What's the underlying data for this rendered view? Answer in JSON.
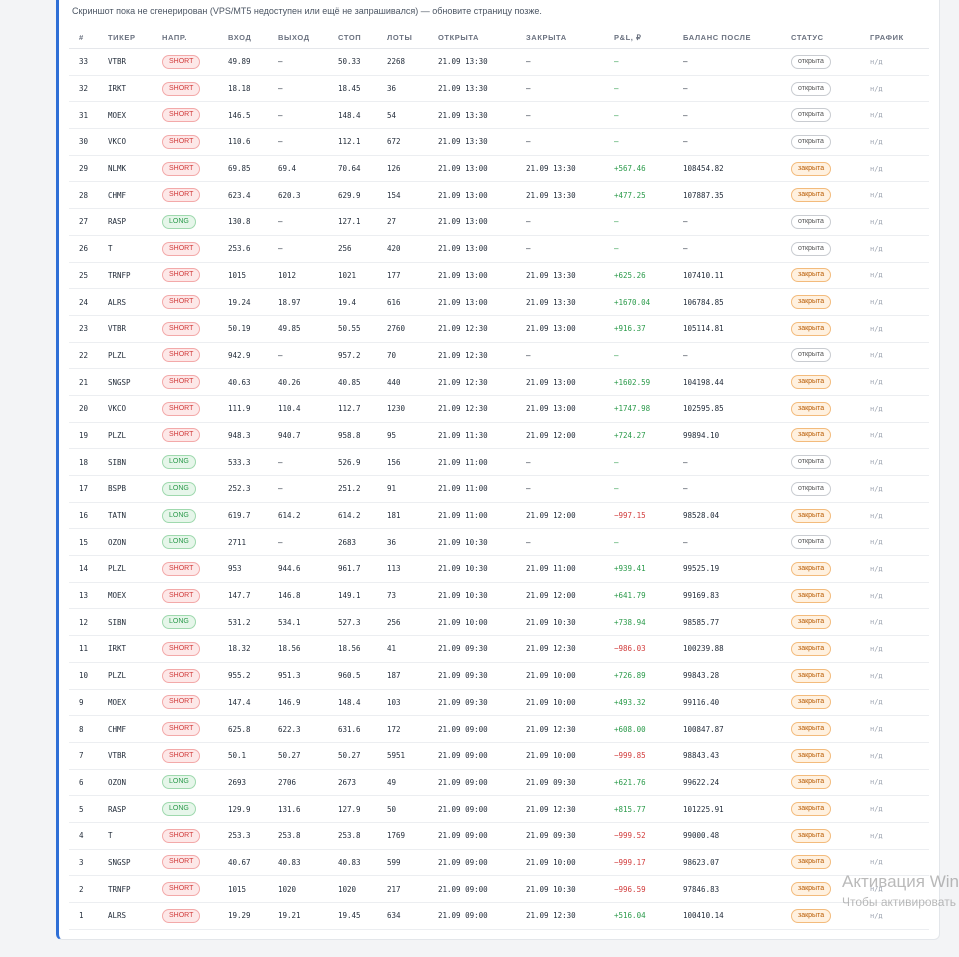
{
  "notice": "Скриншот пока не сгенерирован (VPS/MT5 недоступен или ещё не запрашивался) — обновите страницу позже.",
  "columns": [
    "#",
    "ТИКЕР",
    "НАПР.",
    "ВХОД",
    "ВЫХОД",
    "СТОП",
    "ЛОТЫ",
    "ОТКРЫТА",
    "ЗАКРЫТА",
    "P&L, ₽",
    "БАЛАНС ПОСЛЕ",
    "СТАТУС",
    "ГРАФИК"
  ],
  "colors": {
    "accent": "#2f6fd6",
    "short": "#d13b3b",
    "long": "#2a9a4a",
    "closed": "#b85a00"
  },
  "rows": [
    {
      "n": "33",
      "ticker": "VTBR",
      "dir": "SHORT",
      "entry": "49.89",
      "exit": "–",
      "stop": "50.33",
      "lots": "2268",
      "opened": "21.09 13:30",
      "closed": "–",
      "pnl": "–",
      "balance": "–",
      "status": "открыта",
      "chart": "н/д"
    },
    {
      "n": "32",
      "ticker": "IRKT",
      "dir": "SHORT",
      "entry": "18.18",
      "exit": "–",
      "stop": "18.45",
      "lots": "36",
      "opened": "21.09 13:30",
      "closed": "–",
      "pnl": "–",
      "balance": "–",
      "status": "открыта",
      "chart": "н/д"
    },
    {
      "n": "31",
      "ticker": "MOEX",
      "dir": "SHORT",
      "entry": "146.5",
      "exit": "–",
      "stop": "148.4",
      "lots": "54",
      "opened": "21.09 13:30",
      "closed": "–",
      "pnl": "–",
      "balance": "–",
      "status": "открыта",
      "chart": "н/д"
    },
    {
      "n": "30",
      "ticker": "VKCO",
      "dir": "SHORT",
      "entry": "110.6",
      "exit": "–",
      "stop": "112.1",
      "lots": "672",
      "opened": "21.09 13:30",
      "closed": "–",
      "pnl": "–",
      "balance": "–",
      "status": "открыта",
      "chart": "н/д"
    },
    {
      "n": "29",
      "ticker": "NLMK",
      "dir": "SHORT",
      "entry": "69.85",
      "exit": "69.4",
      "stop": "70.64",
      "lots": "126",
      "opened": "21.09 13:00",
      "closed": "21.09 13:30",
      "pnl": "+567.46",
      "balance": "108454.82",
      "status": "закрыта",
      "chart": "н/д"
    },
    {
      "n": "28",
      "ticker": "CHMF",
      "dir": "SHORT",
      "entry": "623.4",
      "exit": "620.3",
      "stop": "629.9",
      "lots": "154",
      "opened": "21.09 13:00",
      "closed": "21.09 13:30",
      "pnl": "+477.25",
      "balance": "107887.35",
      "status": "закрыта",
      "chart": "н/д"
    },
    {
      "n": "27",
      "ticker": "RASP",
      "dir": "LONG",
      "entry": "130.8",
      "exit": "–",
      "stop": "127.1",
      "lots": "27",
      "opened": "21.09 13:00",
      "closed": "–",
      "pnl": "–",
      "balance": "–",
      "status": "открыта",
      "chart": "н/д"
    },
    {
      "n": "26",
      "ticker": "T",
      "dir": "SHORT",
      "entry": "253.6",
      "exit": "–",
      "stop": "256",
      "lots": "420",
      "opened": "21.09 13:00",
      "closed": "–",
      "pnl": "–",
      "balance": "–",
      "status": "открыта",
      "chart": "н/д"
    },
    {
      "n": "25",
      "ticker": "TRNFP",
      "dir": "SHORT",
      "entry": "1015",
      "exit": "1012",
      "stop": "1021",
      "lots": "177",
      "opened": "21.09 13:00",
      "closed": "21.09 13:30",
      "pnl": "+625.26",
      "balance": "107410.11",
      "status": "закрыта",
      "chart": "н/д"
    },
    {
      "n": "24",
      "ticker": "ALRS",
      "dir": "SHORT",
      "entry": "19.24",
      "exit": "18.97",
      "stop": "19.4",
      "lots": "616",
      "opened": "21.09 13:00",
      "closed": "21.09 13:30",
      "pnl": "+1670.04",
      "balance": "106784.85",
      "status": "закрыта",
      "chart": "н/д"
    },
    {
      "n": "23",
      "ticker": "VTBR",
      "dir": "SHORT",
      "entry": "50.19",
      "exit": "49.85",
      "stop": "50.55",
      "lots": "2760",
      "opened": "21.09 12:30",
      "closed": "21.09 13:00",
      "pnl": "+916.37",
      "balance": "105114.81",
      "status": "закрыта",
      "chart": "н/д"
    },
    {
      "n": "22",
      "ticker": "PLZL",
      "dir": "SHORT",
      "entry": "942.9",
      "exit": "–",
      "stop": "957.2",
      "lots": "70",
      "opened": "21.09 12:30",
      "closed": "–",
      "pnl": "–",
      "balance": "–",
      "status": "открыта",
      "chart": "н/д"
    },
    {
      "n": "21",
      "ticker": "SNGSP",
      "dir": "SHORT",
      "entry": "40.63",
      "exit": "40.26",
      "stop": "40.85",
      "lots": "440",
      "opened": "21.09 12:30",
      "closed": "21.09 13:00",
      "pnl": "+1602.59",
      "balance": "104198.44",
      "status": "закрыта",
      "chart": "н/д"
    },
    {
      "n": "20",
      "ticker": "VKCO",
      "dir": "SHORT",
      "entry": "111.9",
      "exit": "110.4",
      "stop": "112.7",
      "lots": "1230",
      "opened": "21.09 12:30",
      "closed": "21.09 13:00",
      "pnl": "+1747.98",
      "balance": "102595.85",
      "status": "закрыта",
      "chart": "н/д"
    },
    {
      "n": "19",
      "ticker": "PLZL",
      "dir": "SHORT",
      "entry": "948.3",
      "exit": "940.7",
      "stop": "958.8",
      "lots": "95",
      "opened": "21.09 11:30",
      "closed": "21.09 12:00",
      "pnl": "+724.27",
      "balance": "99894.10",
      "status": "закрыта",
      "chart": "н/д"
    },
    {
      "n": "18",
      "ticker": "SIBN",
      "dir": "LONG",
      "entry": "533.3",
      "exit": "–",
      "stop": "526.9",
      "lots": "156",
      "opened": "21.09 11:00",
      "closed": "–",
      "pnl": "–",
      "balance": "–",
      "status": "открыта",
      "chart": "н/д"
    },
    {
      "n": "17",
      "ticker": "BSPB",
      "dir": "LONG",
      "entry": "252.3",
      "exit": "–",
      "stop": "251.2",
      "lots": "91",
      "opened": "21.09 11:00",
      "closed": "–",
      "pnl": "–",
      "balance": "–",
      "status": "открыта",
      "chart": "н/д"
    },
    {
      "n": "16",
      "ticker": "TATN",
      "dir": "LONG",
      "entry": "619.7",
      "exit": "614.2",
      "stop": "614.2",
      "lots": "181",
      "opened": "21.09 11:00",
      "closed": "21.09 12:00",
      "pnl": "−997.15",
      "balance": "98528.04",
      "status": "закрыта",
      "chart": "н/д"
    },
    {
      "n": "15",
      "ticker": "OZON",
      "dir": "LONG",
      "entry": "2711",
      "exit": "–",
      "stop": "2683",
      "lots": "36",
      "opened": "21.09 10:30",
      "closed": "–",
      "pnl": "–",
      "balance": "–",
      "status": "открыта",
      "chart": "н/д"
    },
    {
      "n": "14",
      "ticker": "PLZL",
      "dir": "SHORT",
      "entry": "953",
      "exit": "944.6",
      "stop": "961.7",
      "lots": "113",
      "opened": "21.09 10:30",
      "closed": "21.09 11:00",
      "pnl": "+939.41",
      "balance": "99525.19",
      "status": "закрыта",
      "chart": "н/д"
    },
    {
      "n": "13",
      "ticker": "MOEX",
      "dir": "SHORT",
      "entry": "147.7",
      "exit": "146.8",
      "stop": "149.1",
      "lots": "73",
      "opened": "21.09 10:30",
      "closed": "21.09 12:00",
      "pnl": "+641.79",
      "balance": "99169.83",
      "status": "закрыта",
      "chart": "н/д"
    },
    {
      "n": "12",
      "ticker": "SIBN",
      "dir": "LONG",
      "entry": "531.2",
      "exit": "534.1",
      "stop": "527.3",
      "lots": "256",
      "opened": "21.09 10:00",
      "closed": "21.09 10:30",
      "pnl": "+738.94",
      "balance": "98585.77",
      "status": "закрыта",
      "chart": "н/д"
    },
    {
      "n": "11",
      "ticker": "IRKT",
      "dir": "SHORT",
      "entry": "18.32",
      "exit": "18.56",
      "stop": "18.56",
      "lots": "41",
      "opened": "21.09 09:30",
      "closed": "21.09 12:30",
      "pnl": "−986.03",
      "balance": "100239.88",
      "status": "закрыта",
      "chart": "н/д"
    },
    {
      "n": "10",
      "ticker": "PLZL",
      "dir": "SHORT",
      "entry": "955.2",
      "exit": "951.3",
      "stop": "960.5",
      "lots": "187",
      "opened": "21.09 09:30",
      "closed": "21.09 10:00",
      "pnl": "+726.89",
      "balance": "99843.28",
      "status": "закрыта",
      "chart": "н/д"
    },
    {
      "n": "9",
      "ticker": "MOEX",
      "dir": "SHORT",
      "entry": "147.4",
      "exit": "146.9",
      "stop": "148.4",
      "lots": "103",
      "opened": "21.09 09:30",
      "closed": "21.09 10:00",
      "pnl": "+493.32",
      "balance": "99116.40",
      "status": "закрыта",
      "chart": "н/д"
    },
    {
      "n": "8",
      "ticker": "CHMF",
      "dir": "SHORT",
      "entry": "625.8",
      "exit": "622.3",
      "stop": "631.6",
      "lots": "172",
      "opened": "21.09 09:00",
      "closed": "21.09 12:30",
      "pnl": "+608.00",
      "balance": "100847.87",
      "status": "закрыта",
      "chart": "н/д"
    },
    {
      "n": "7",
      "ticker": "VTBR",
      "dir": "SHORT",
      "entry": "50.1",
      "exit": "50.27",
      "stop": "50.27",
      "lots": "5951",
      "opened": "21.09 09:00",
      "closed": "21.09 10:00",
      "pnl": "−999.85",
      "balance": "98843.43",
      "status": "закрыта",
      "chart": "н/д"
    },
    {
      "n": "6",
      "ticker": "OZON",
      "dir": "LONG",
      "entry": "2693",
      "exit": "2706",
      "stop": "2673",
      "lots": "49",
      "opened": "21.09 09:00",
      "closed": "21.09 09:30",
      "pnl": "+621.76",
      "balance": "99622.24",
      "status": "закрыта",
      "chart": "н/д"
    },
    {
      "n": "5",
      "ticker": "RASP",
      "dir": "LONG",
      "entry": "129.9",
      "exit": "131.6",
      "stop": "127.9",
      "lots": "50",
      "opened": "21.09 09:00",
      "closed": "21.09 12:30",
      "pnl": "+815.77",
      "balance": "101225.91",
      "status": "закрыта",
      "chart": "н/д"
    },
    {
      "n": "4",
      "ticker": "T",
      "dir": "SHORT",
      "entry": "253.3",
      "exit": "253.8",
      "stop": "253.8",
      "lots": "1769",
      "opened": "21.09 09:00",
      "closed": "21.09 09:30",
      "pnl": "−999.52",
      "balance": "99000.48",
      "status": "закрыта",
      "chart": "н/д"
    },
    {
      "n": "3",
      "ticker": "SNGSP",
      "dir": "SHORT",
      "entry": "40.67",
      "exit": "40.83",
      "stop": "40.83",
      "lots": "599",
      "opened": "21.09 09:00",
      "closed": "21.09 10:00",
      "pnl": "−999.17",
      "balance": "98623.07",
      "status": "закрыта",
      "chart": "н/д"
    },
    {
      "n": "2",
      "ticker": "TRNFP",
      "dir": "SHORT",
      "entry": "1015",
      "exit": "1020",
      "stop": "1020",
      "lots": "217",
      "opened": "21.09 09:00",
      "closed": "21.09 10:30",
      "pnl": "−996.59",
      "balance": "97846.83",
      "status": "закрыта",
      "chart": "н/д"
    },
    {
      "n": "1",
      "ticker": "ALRS",
      "dir": "SHORT",
      "entry": "19.29",
      "exit": "19.21",
      "stop": "19.45",
      "lots": "634",
      "opened": "21.09 09:00",
      "closed": "21.09 12:30",
      "pnl": "+516.04",
      "balance": "100410.14",
      "status": "закрыта",
      "chart": "н/д"
    }
  ],
  "watermark": {
    "title": "Активация Windows",
    "subtitle": "Чтобы активировать Windows, перейдите в раздел «Параметры»."
  }
}
